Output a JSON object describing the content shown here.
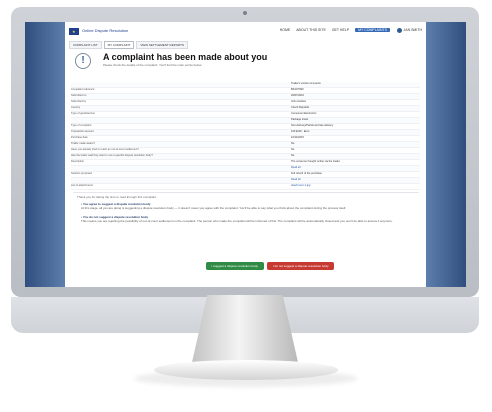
{
  "window": {
    "site_name": "Online Dispute Resolution",
    "nav": {
      "home": "HOME",
      "about": "ABOUT THIS SITE",
      "help": "GET HELP",
      "complaints": "MY COMPLAINTS"
    },
    "user": "JAN SMITH"
  },
  "tabs": [
    "COMPLAINT LIST",
    "MY COMPLAINT",
    "VIEW SETTLEMENT REPORTS"
  ],
  "header": {
    "title": "A complaint has been made about you",
    "subtitle": "Please check the details of the complaint. You'll find the main points below."
  },
  "details": [
    {
      "label": "",
      "value": "Trader's version of events"
    },
    {
      "label": "Complaint reference",
      "value": "BF4O7699"
    },
    {
      "label": "Submitted on",
      "value": "20/07/2016"
    },
    {
      "label": "Submitted by",
      "value": "John Andrew"
    },
    {
      "label": "Country",
      "value": "Czech Republic"
    },
    {
      "label": "Type of good/service",
      "value": "Consumer Electronics"
    },
    {
      "label": "",
      "value": "Package travel"
    },
    {
      "label": "Type of complaint",
      "value": "Non-delivery/Partial and late delivery"
    },
    {
      "label": "Transaction amount",
      "value": "100 EUR - Euro"
    },
    {
      "label": "Purchase date",
      "value": "10/11/2015"
    },
    {
      "label": "Trader made aware?",
      "value": "No"
    },
    {
      "label": "Have you already tried to reach an out-of-court settlement?",
      "value": "No"
    },
    {
      "label": "Has the trader said they want to use a specific dispute resolution body?",
      "value": "No"
    },
    {
      "label": "Description",
      "value": "The consumer bought online via the trader."
    },
    {
      "label": "",
      "value": "Read all"
    },
    {
      "label": "Solution proposed",
      "value": "Full refund of the purchase"
    },
    {
      "label": "",
      "value": "Read all"
    },
    {
      "label": "List of attachments",
      "value": "attachment-1.jpg"
    }
  ],
  "panel": {
    "intro": "Thank you for taking the time to read through this complaint.",
    "choice1_title": "You agree to suggest a dispute resolution body",
    "choice1_text": "At this stage, all you are doing is suggesting a dispute resolution body — it doesn't mean you agree with the complaint. You'll be able to say what you think about the complaint during the process itself.",
    "choice2_title": "You do not suggest a dispute resolution body",
    "choice2_text": "This means you are rejecting the possibility of out-of-court settlement on the complaint. The person who made the complaint will be informed of this. The complaint will be automatically closed and you won't be able to access it anymore."
  },
  "actions": {
    "accept": "I suggest a dispute resolution body",
    "reject": "I do not suggest a dispute resolution body"
  }
}
